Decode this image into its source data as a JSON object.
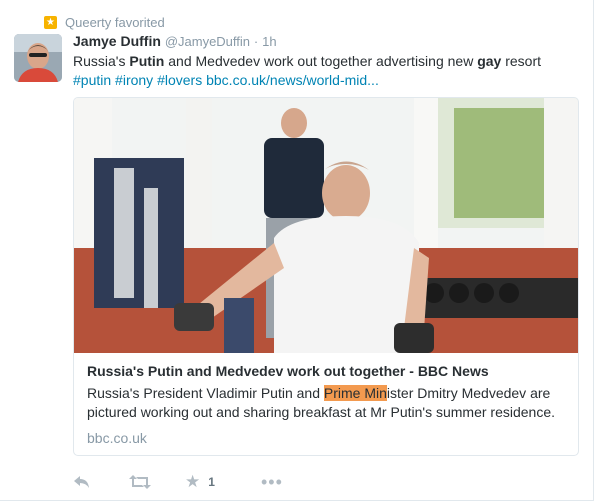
{
  "context": {
    "label": "Queerty favorited",
    "icon": "star-icon"
  },
  "tweet": {
    "author_name": "Jamye Duffin",
    "handle": "@JamyeDuffin",
    "separator": "·",
    "time": "1h",
    "text_parts": [
      "Russia's ",
      "Putin",
      " and Medvedev work out together advertising new ",
      "gay",
      " resort"
    ],
    "hashtags": [
      "#putin",
      "#irony",
      "#lovers"
    ],
    "url": "bbc.co.uk/news/world-mid..."
  },
  "card": {
    "title": "Russia's Putin and Medvedev work out together - BBC News",
    "desc_before": "Russia's President Vladimir Putin and ",
    "desc_highlight": "Prime Min",
    "desc_after": "ister Dmitry Medvedev are pictured working out and sharing breakfast at Mr Putin's summer residence.",
    "domain": "bbc.co.uk"
  },
  "actions": {
    "reply_icon": "reply-icon",
    "retweet_icon": "retweet-icon",
    "favorite_icon": "star-icon",
    "favorite_count": "1",
    "more_icon": "more-icon"
  }
}
